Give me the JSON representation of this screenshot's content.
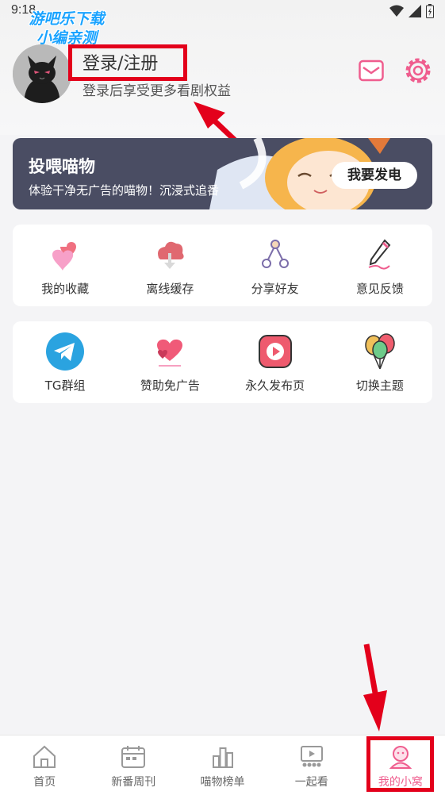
{
  "status_bar": {
    "time": "9:18"
  },
  "watermark": {
    "line1": "游吧乐下载",
    "line2": "小编亲测"
  },
  "profile": {
    "login_label": "登录/注册",
    "subtitle": "登录后享受更多看剧权益"
  },
  "header_icons": {
    "message": "mail-icon",
    "settings": "gear-icon"
  },
  "banner": {
    "title": "投喂喵物",
    "subtitle": "体验干净无广告的喵物！沉浸式追番",
    "button": "我要发电"
  },
  "grid1": [
    {
      "label": "我的收藏",
      "icon": "hearts-icon"
    },
    {
      "label": "离线缓存",
      "icon": "cloud-download-icon"
    },
    {
      "label": "分享好友",
      "icon": "share-icon"
    },
    {
      "label": "意见反馈",
      "icon": "pen-icon"
    }
  ],
  "grid2": [
    {
      "label": "TG群组",
      "icon": "telegram-icon"
    },
    {
      "label": "赞助免广告",
      "icon": "heart-sponsor-icon"
    },
    {
      "label": "永久发布页",
      "icon": "play-icon"
    },
    {
      "label": "切换主题",
      "icon": "balloons-icon"
    }
  ],
  "tabs": [
    {
      "label": "首页",
      "icon": "home-icon"
    },
    {
      "label": "新番周刊",
      "icon": "calendar-icon"
    },
    {
      "label": "喵物榜单",
      "icon": "ranking-icon"
    },
    {
      "label": "一起看",
      "icon": "watch-together-icon"
    },
    {
      "label": "我的小窝",
      "icon": "profile-icon",
      "active": true
    }
  ],
  "colors": {
    "accent": "#ef5d8e",
    "annotation": "#e3001b",
    "banner_bg": "#4a4d63"
  }
}
